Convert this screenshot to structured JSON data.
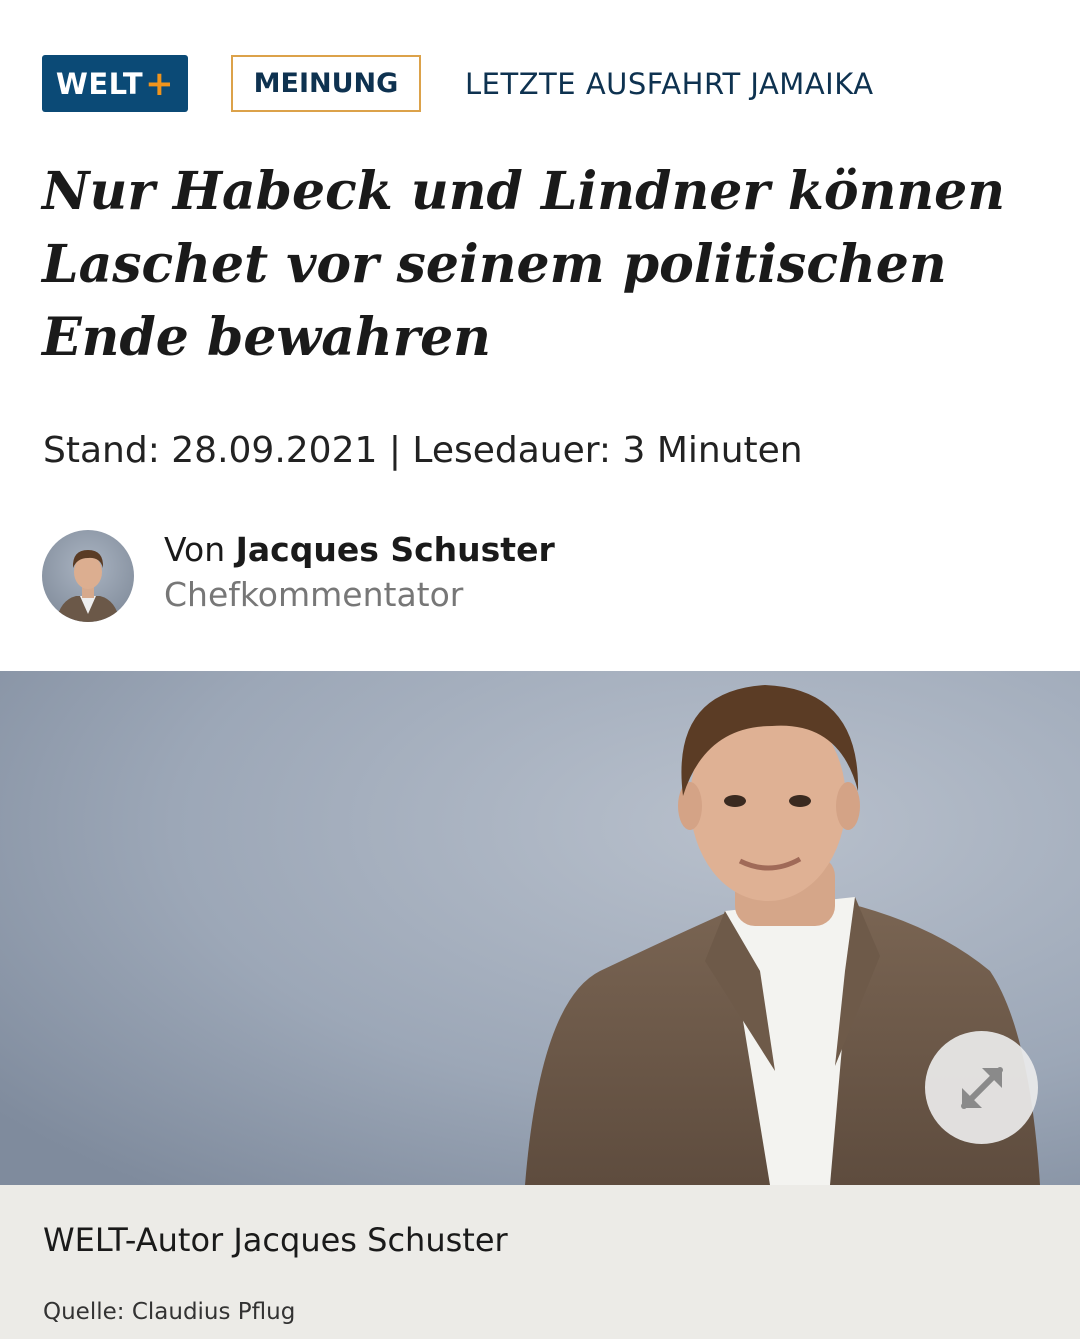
{
  "header": {
    "brand": "WELT",
    "brand_plus": "+",
    "category": "MEINUNG",
    "series": "LETZTE AUSFAHRT JAMAIKA"
  },
  "article": {
    "headline": "Nur Habeck und Lindner können Laschet vor seinem politischen Ende bewahren",
    "meta": "Stand: 28.09.2021 | Lesedauer: 3 Minuten"
  },
  "author": {
    "prefix": "Von ",
    "name": "Jacques Schuster",
    "role": "Chefkommentator"
  },
  "image": {
    "caption": "WELT-Autor Jacques Schuster",
    "source": "Quelle: Claudius Pflug"
  },
  "icons": {
    "expand": "expand-arrows-icon"
  },
  "colors": {
    "brand_blue": "#0b4a76",
    "brand_orange": "#f0941c",
    "category_border": "#dca24a",
    "accent_text": "#0e3250",
    "caption_bg": "#ecebe7"
  }
}
